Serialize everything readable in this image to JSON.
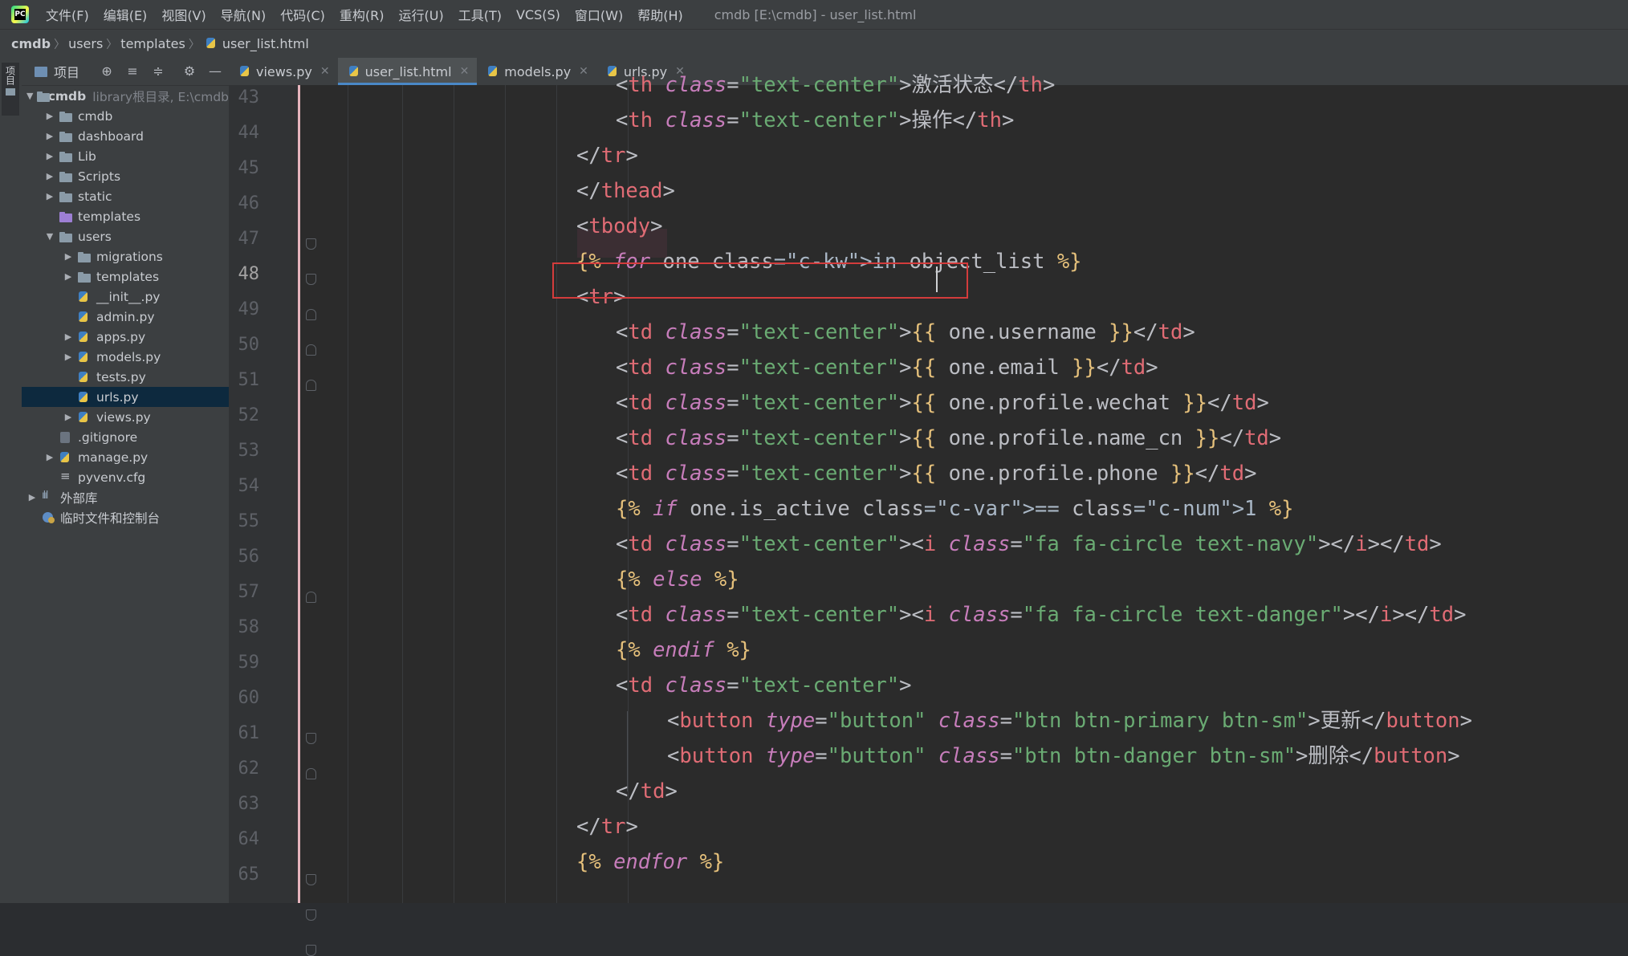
{
  "menubar": {
    "items": [
      "文件(F)",
      "编辑(E)",
      "视图(V)",
      "导航(N)",
      "代码(C)",
      "重构(R)",
      "运行(U)",
      "工具(T)",
      "VCS(S)",
      "窗口(W)",
      "帮助(H)"
    ],
    "window_title": "cmdb [E:\\cmdb] - user_list.html"
  },
  "breadcrumb": {
    "items": [
      "cmdb",
      "users",
      "templates",
      "user_list.html"
    ]
  },
  "left_stripe": {
    "label": "项目"
  },
  "project_panel": {
    "title": "项目",
    "tree": [
      {
        "label": "cmdb",
        "hint": "library根目录,  E:\\cmdb",
        "type": "folder"
      },
      {
        "label": "cmdb",
        "type": "folder"
      },
      {
        "label": "dashboard",
        "type": "folder"
      },
      {
        "label": "Lib",
        "type": "folder"
      },
      {
        "label": "Scripts",
        "type": "folder"
      },
      {
        "label": "static",
        "type": "folder"
      },
      {
        "label": "templates",
        "type": "folder-purple"
      },
      {
        "label": "users",
        "type": "folder"
      },
      {
        "label": "migrations",
        "type": "folder"
      },
      {
        "label": "templates",
        "type": "folder"
      },
      {
        "label": "__init__.py",
        "type": "py"
      },
      {
        "label": "admin.py",
        "type": "py"
      },
      {
        "label": "apps.py",
        "type": "py"
      },
      {
        "label": "models.py",
        "type": "py"
      },
      {
        "label": "tests.py",
        "type": "py"
      },
      {
        "label": "urls.py",
        "type": "py"
      },
      {
        "label": "views.py",
        "type": "py"
      },
      {
        "label": ".gitignore",
        "type": "git"
      },
      {
        "label": "manage.py",
        "type": "py"
      },
      {
        "label": "pyvenv.cfg",
        "type": "cfg"
      },
      {
        "label": "外部库",
        "type": "lib"
      },
      {
        "label": "临时文件和控制台",
        "type": "scratch"
      }
    ]
  },
  "tabs": [
    {
      "label": "views.py",
      "active": false
    },
    {
      "label": "user_list.html",
      "active": true
    },
    {
      "label": "models.py",
      "active": false
    },
    {
      "label": "urls.py",
      "active": false
    }
  ],
  "editor": {
    "line_numbers": [
      "43",
      "44",
      "45",
      "46",
      "47",
      "48",
      "49",
      "50",
      "51",
      "52",
      "53",
      "54",
      "55",
      "56",
      "57",
      "58",
      "59",
      "60",
      "61",
      "62",
      "63",
      "64",
      "65"
    ],
    "current_line": "48",
    "lines": [
      "<th class=\"text-center\">激活状态</th>",
      "<th class=\"text-center\">操作</th>",
      "</tr>",
      "</thead>",
      "<tbody>",
      "{% for one in object_list %}",
      "<tr>",
      "<td class=\"text-center\">{{ one.username }}</td>",
      "<td class=\"text-center\">{{ one.email }}</td>",
      "<td class=\"text-center\">{{ one.profile.wechat }}</td>",
      "<td class=\"text-center\">{{ one.profile.name_cn }}</td>",
      "<td class=\"text-center\">{{ one.profile.phone }}</td>",
      "{% if one.is_active == 1 %}",
      "<td class=\"text-center\"><i class=\"fa fa-circle text-navy\"></i></td>",
      "{% else %}",
      "<td class=\"text-center\"><i class=\"fa fa-circle text-danger\"></i></td>",
      "{% endif %}",
      "<td class=\"text-center\">",
      "<button type=\"button\" class=\"btn btn-primary btn-sm\">更新</button>",
      "<button type=\"button\" class=\"btn btn-danger btn-sm\">删除</button>",
      "</td>",
      "</tr>",
      "{% endfor %}"
    ]
  },
  "colors": {
    "accent": "#4a88c7",
    "highlight_box": "#d33c3c",
    "editor_bg": "#2b2b2b",
    "selected_tree_row": "#0d293e"
  }
}
